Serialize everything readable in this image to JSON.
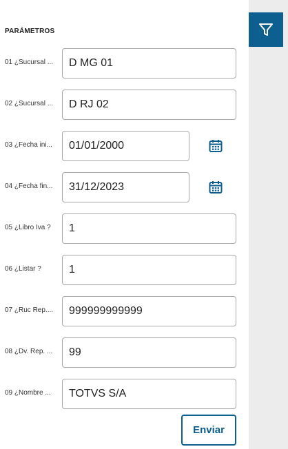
{
  "section": {
    "title": "PARÁMETROS"
  },
  "params": [
    {
      "label": "01 ¿Sucursal ...",
      "value": "D MG 01"
    },
    {
      "label": "02 ¿Sucursal ...",
      "value": "D RJ 02"
    },
    {
      "label": "03 ¿Fecha ini...",
      "value": "01/01/2000",
      "icon": "calendar-icon"
    },
    {
      "label": "04 ¿Fecha fin...",
      "value": "31/12/2023",
      "icon": "calendar-icon"
    },
    {
      "label": "05 ¿Libro Iva ?",
      "value": "1"
    },
    {
      "label": "06 ¿Listar ?",
      "value": "1"
    },
    {
      "label": "07 ¿Ruc Rep....",
      "value": "999999999999"
    },
    {
      "label": "08 ¿Dv. Rep. ...",
      "value": "99"
    },
    {
      "label": "09 ¿Nombre ...",
      "value": "TOTVS S/A"
    }
  ],
  "actions": {
    "send_label": "Enviar"
  },
  "sidebar": {
    "filter_icon": "filter-icon"
  },
  "colors": {
    "accent": "#0c5f8f",
    "sidebar_bg": "#ececec",
    "border": "#a9a9a9"
  }
}
